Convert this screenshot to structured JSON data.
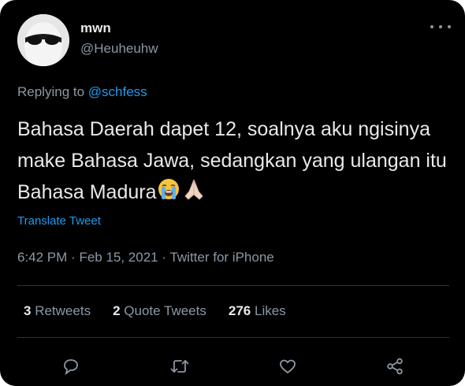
{
  "author": {
    "name": "mwn",
    "handle": "@Heuheuhw"
  },
  "replying": {
    "prefix": "Replying to",
    "to": "@schfess"
  },
  "tweet": {
    "text": "Bahasa Daerah dapet 12, soalnya aku ngisinya make Bahasa Jawa, sedangkan yang ulangan itu Bahasa Madura",
    "emojis": [
      "crying-face",
      "folded-hands"
    ]
  },
  "translate_label": "Translate Tweet",
  "meta": {
    "time": "6:42 PM",
    "date": "Feb 15, 2021",
    "source": "Twitter for iPhone"
  },
  "stats": {
    "retweets_count": "3",
    "retweets_label": "Retweets",
    "quotes_count": "2",
    "quotes_label": "Quote Tweets",
    "likes_count": "276",
    "likes_label": "Likes"
  },
  "actions": [
    "reply-icon",
    "retweet-icon",
    "like-icon",
    "share-icon"
  ],
  "colors": {
    "background": "#000000",
    "text": "#e7e9ea",
    "secondary": "#8b98a5",
    "link": "#1d9bf0",
    "divider": "#2f3336"
  }
}
